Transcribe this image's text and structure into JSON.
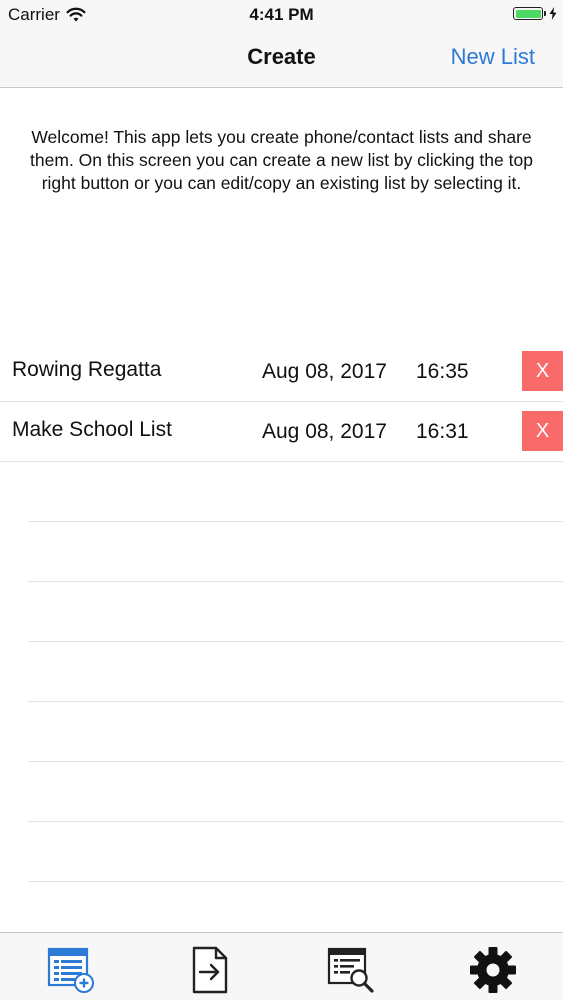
{
  "status_bar": {
    "carrier": "Carrier",
    "time": "4:41 PM",
    "battery_level": 1.0,
    "charging": true
  },
  "nav": {
    "title": "Create",
    "right_button": "New List"
  },
  "welcome_text": "Welcome! This app lets you create phone/contact lists and share them. On this screen you can create a new list by clicking the top right button or you can edit/copy an existing list by selecting it.",
  "lists": [
    {
      "name": "Rowing Regatta",
      "date": "Aug 08, 2017",
      "time": "16:35",
      "delete_label": "X"
    },
    {
      "name": "Make School List",
      "date": "Aug 08, 2017",
      "time": "16:31",
      "delete_label": "X"
    }
  ],
  "tab_bar": {
    "tabs": [
      {
        "icon": "create-list-icon",
        "selected": true
      },
      {
        "icon": "share-export-icon",
        "selected": false
      },
      {
        "icon": "search-list-icon",
        "selected": false
      },
      {
        "icon": "settings-gear-icon",
        "selected": false
      }
    ]
  },
  "colors": {
    "accent": "#2c7ad6",
    "delete": "#f96b6b",
    "battery": "#4cd964"
  }
}
